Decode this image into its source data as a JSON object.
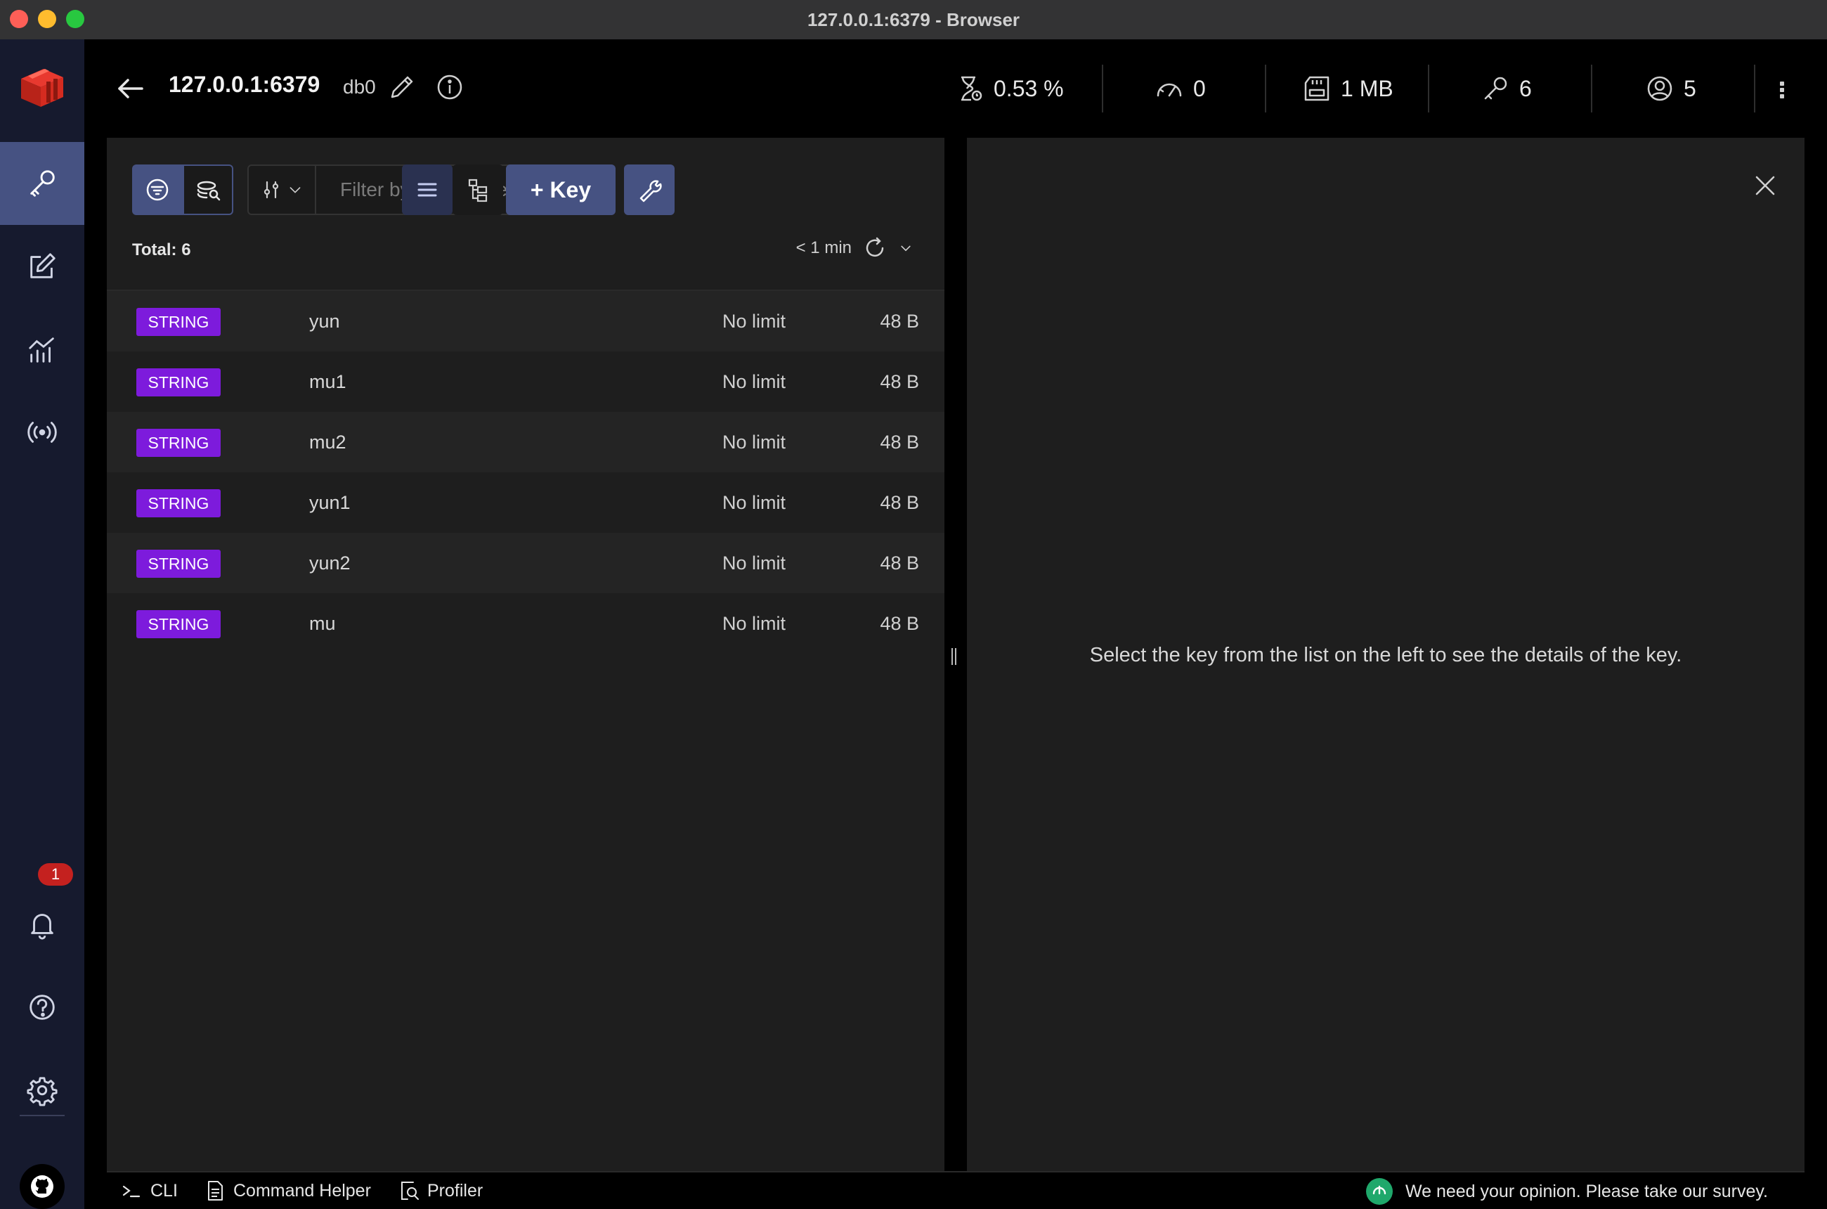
{
  "window": {
    "title": "127.0.0.1:6379 - Browser"
  },
  "header": {
    "host": "127.0.0.1:6379",
    "db": "db0",
    "stats": {
      "cpu": "0.53 %",
      "ops": "0",
      "memory": "1 MB",
      "keys": "6",
      "clients": "5"
    }
  },
  "sidebar": {
    "notifications_count": "1"
  },
  "toolbar": {
    "search_placeholder": "Filter by Key Name",
    "add_key_label": "+ Key"
  },
  "list": {
    "total_label": "Total: 6",
    "refresh_label": "< 1 min",
    "rows": [
      {
        "type": "STRING",
        "name": "yun",
        "ttl": "No limit",
        "size": "48 B"
      },
      {
        "type": "STRING",
        "name": "mu1",
        "ttl": "No limit",
        "size": "48 B"
      },
      {
        "type": "STRING",
        "name": "mu2",
        "ttl": "No limit",
        "size": "48 B"
      },
      {
        "type": "STRING",
        "name": "yun1",
        "ttl": "No limit",
        "size": "48 B"
      },
      {
        "type": "STRING",
        "name": "yun2",
        "ttl": "No limit",
        "size": "48 B"
      },
      {
        "type": "STRING",
        "name": "mu",
        "ttl": "No limit",
        "size": "48 B"
      }
    ]
  },
  "details": {
    "empty_message": "Select the key from the list on the left to see the details of the key."
  },
  "bottom": {
    "cli_label": "CLI",
    "command_helper_label": "Command Helper",
    "profiler_label": "Profiler",
    "survey_label": "We need your opinion. Please take our survey."
  },
  "colors": {
    "accent": "#465282",
    "string_tag": "#7d1bdc",
    "sidebar_bg": "#161a2e",
    "panel_bg": "#1e1e1e"
  }
}
